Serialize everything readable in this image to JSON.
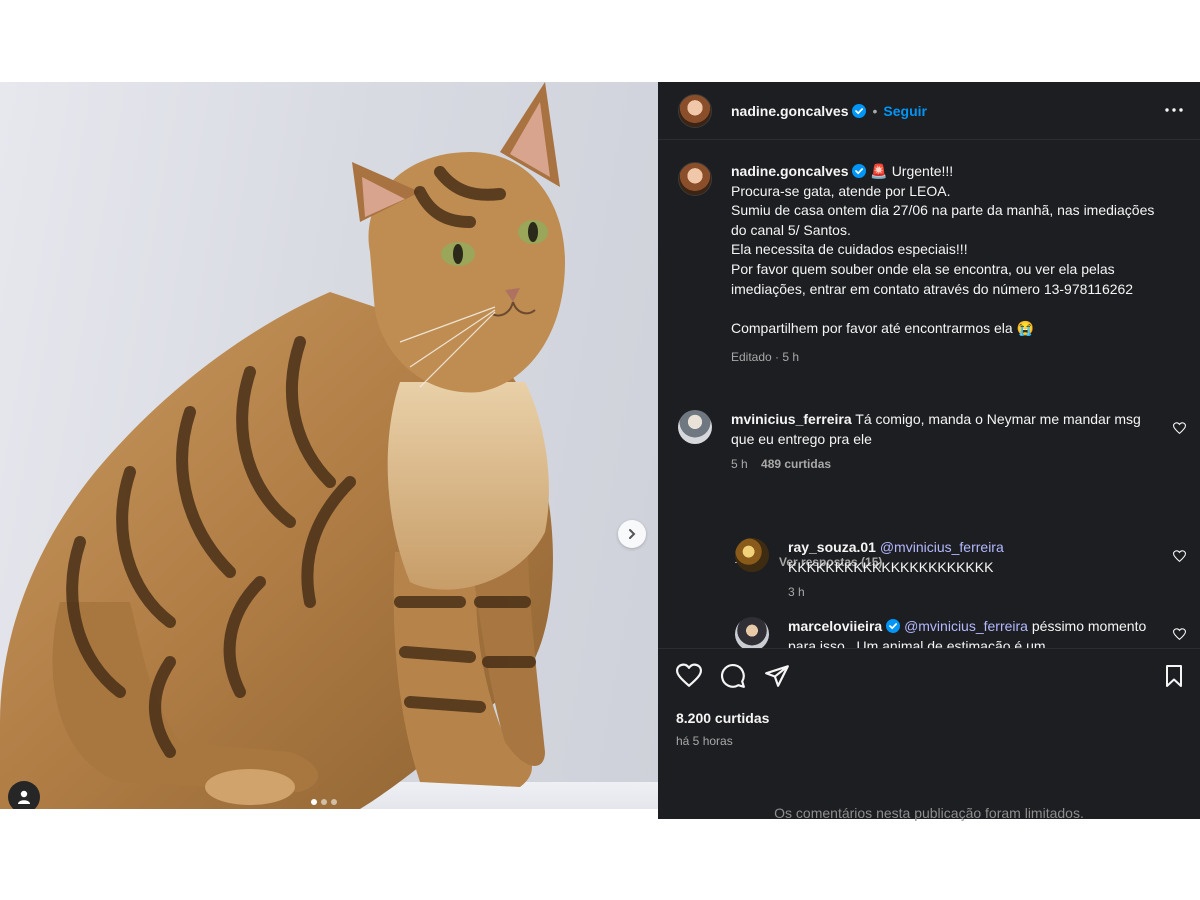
{
  "post": {
    "author": "nadine.goncalves",
    "follow_label": "Seguir",
    "header_separator": "•",
    "caption_lines": [
      "🚨 Urgente!!!",
      "Procura-se gata, atende por LEOA.",
      "Sumiu de casa ontem dia 27/06 na parte da manhã, nas imediações do canal 5/ Santos.",
      "Ela necessita de cuidados especiais!!!",
      "Por favor quem souber onde ela se encontra, ou ver ela pelas imediações, entrar em contato através do número 13-978116262",
      "",
      "Compartilhem por favor até encontrarmos ela 😭"
    ],
    "caption_meta": "Editado · 5 h",
    "likes": "8.200 curtidas",
    "posted_time": "há 5 horas",
    "comments_limited": "Os comentários nesta publicação foram limitados.",
    "carousel": {
      "slides": 3,
      "active_slide": 1
    }
  },
  "comments": [
    {
      "user": "mvinicius_ferreira",
      "text": "Tá comigo, manda o Neymar me mandar msg que eu entrego pra ele",
      "time": "5 h",
      "likes": "489 curtidas",
      "replies_label": "Ver respostas (15)"
    }
  ],
  "replies": [
    {
      "user": "ray_souza.01",
      "mention": "@mvinicius_ferreira",
      "text": "KKKKKKKKKKKKKKKKKKKKKK",
      "time": "3 h"
    },
    {
      "user": "marceloviieira",
      "mention": "@mvinicius_ferreira",
      "text": "péssimo momento para isso . Um animal de estimação é um"
    }
  ],
  "colors": {
    "panel_bg": "#1d1e21",
    "link_blue": "#0095f6",
    "mention": "#b3b8ff",
    "verified": "#0095f6",
    "muted": "#a8a8a8"
  },
  "icons": [
    "verified-badge-icon",
    "more-options-icon",
    "heart-icon",
    "comment-icon",
    "share-icon",
    "bookmark-icon",
    "chevron-right-icon",
    "user-tag-icon"
  ]
}
